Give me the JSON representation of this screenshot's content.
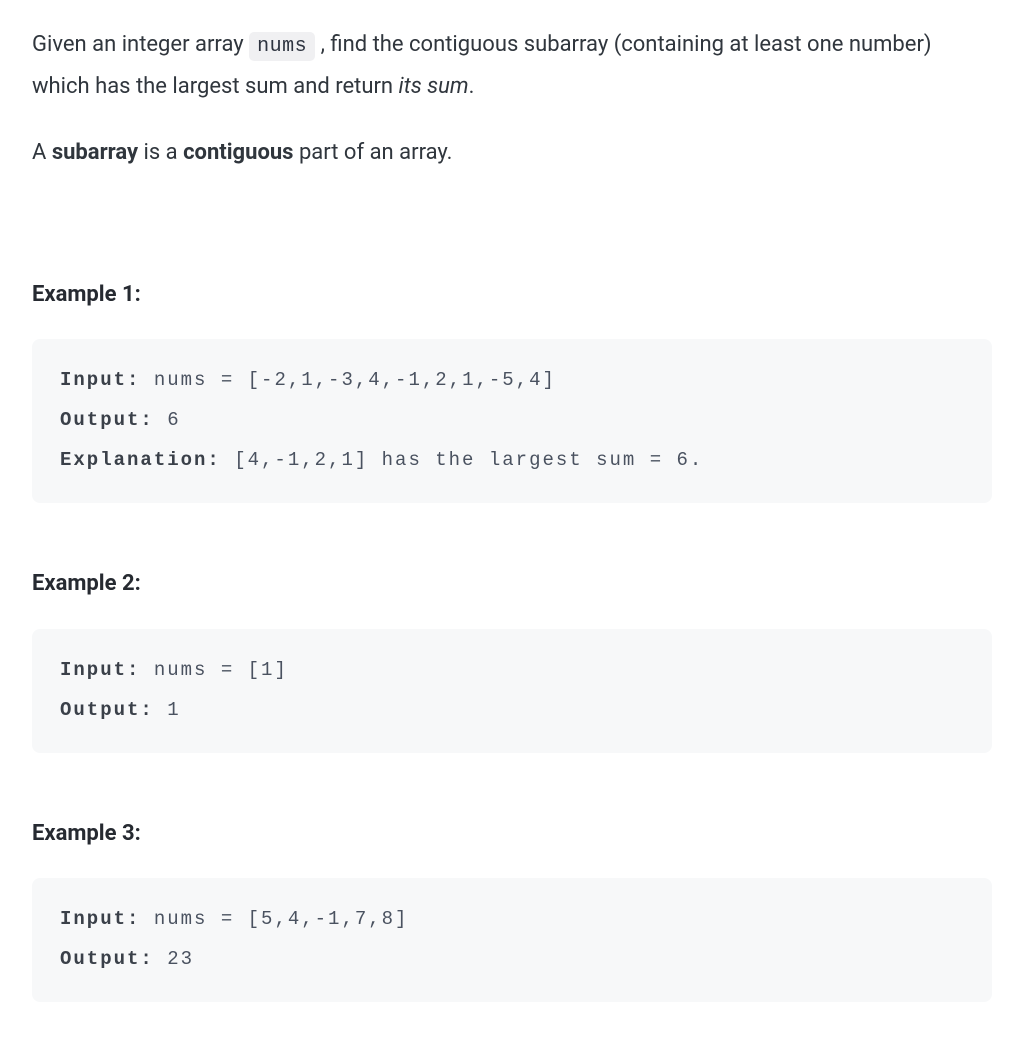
{
  "description": {
    "para1_before": "Given an integer array ",
    "para1_code": "nums",
    "para1_after": " , find the contiguous subarray (containing at least one number) which has the largest sum and return ",
    "para1_italic": "its sum",
    "para1_end": ".",
    "para2_before": "A ",
    "para2_bold1": "subarray",
    "para2_mid": " is a ",
    "para2_bold2": "contiguous",
    "para2_after": " part of an array."
  },
  "examples": [
    {
      "heading": "Example 1:",
      "lines": [
        {
          "label": "Input:",
          "text": " nums = [-2,1,-3,4,-1,2,1,-5,4]"
        },
        {
          "label": "Output:",
          "text": " 6"
        },
        {
          "label": "Explanation:",
          "text": " [4,-1,2,1] has the largest sum = 6."
        }
      ]
    },
    {
      "heading": "Example 2:",
      "lines": [
        {
          "label": "Input:",
          "text": " nums = [1]"
        },
        {
          "label": "Output:",
          "text": " 1"
        }
      ]
    },
    {
      "heading": "Example 3:",
      "lines": [
        {
          "label": "Input:",
          "text": " nums = [5,4,-1,7,8]"
        },
        {
          "label": "Output:",
          "text": " 23"
        }
      ]
    }
  ]
}
